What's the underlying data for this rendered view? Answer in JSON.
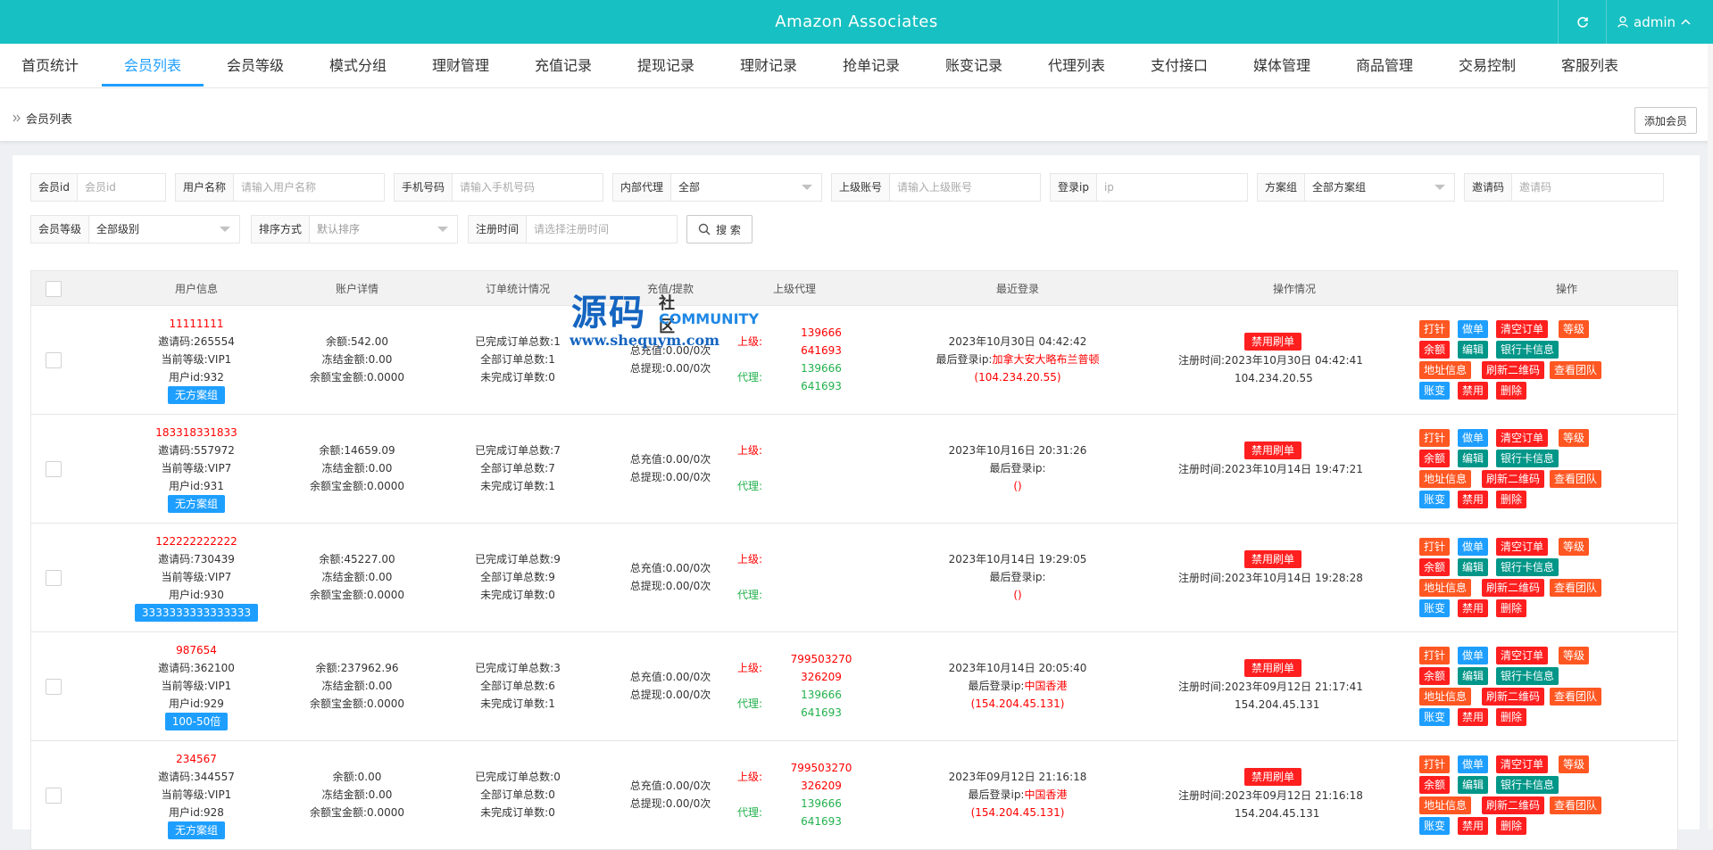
{
  "app": {
    "title": "Amazon Associates",
    "user": "admin"
  },
  "nav": {
    "items": [
      "首页统计",
      "会员列表",
      "会员等级",
      "模式分组",
      "理财管理",
      "充值记录",
      "提现记录",
      "理财记录",
      "抢单记录",
      "账变记录",
      "代理列表",
      "支付接口",
      "媒体管理",
      "商品管理",
      "交易控制",
      "客服列表"
    ],
    "active_index": 1
  },
  "breadcrumb": "会员列表",
  "add_button": "添加会员",
  "filters": {
    "member_id": {
      "label": "会员id",
      "placeholder": "会员id"
    },
    "username": {
      "label": "用户名称",
      "placeholder": "请输入用户名称"
    },
    "phone": {
      "label": "手机号码",
      "placeholder": "请输入手机号码"
    },
    "agent": {
      "label": "内部代理",
      "value": "全部"
    },
    "parent": {
      "label": "上级账号",
      "placeholder": "请输入上级账号"
    },
    "login_ip": {
      "label": "登录ip",
      "placeholder": "ip"
    },
    "plan": {
      "label": "方案组",
      "value": "全部方案组"
    },
    "invite": {
      "label": "邀请码",
      "placeholder": "邀请码"
    },
    "level": {
      "label": "会员等级",
      "value": "全部级别"
    },
    "sort": {
      "label": "排序方式",
      "value": "默认排序"
    },
    "reg_time": {
      "label": "注册时间",
      "placeholder": "请选择注册时间"
    },
    "search_label": "搜 索"
  },
  "table": {
    "headers": [
      "用户信息",
      "账户详情",
      "订单统计情况",
      "充值/提款",
      "上级代理",
      "最近登录",
      "操作情况",
      "操作"
    ],
    "rows": [
      {
        "username": "11111111",
        "invite": "邀请码:265554",
        "level": "当前等级:VIP1",
        "uid": "用户id:932",
        "group": "无方案组",
        "balance": "余额:542.00",
        "frozen": "冻结金额:0.00",
        "treasure": "余额宝金额:0.0000",
        "done": "已完成订单总数:1",
        "total": "全部订单总数:1",
        "pending": "未完成订单数:0",
        "recharge": "总充值:0.00/0次",
        "withdraw": "总提现:0.00/0次",
        "up_label": "上级:",
        "agent_label": "代理:",
        "up": [
          "139666",
          "641693"
        ],
        "agent": [
          "139666",
          "641693"
        ],
        "login_time": "2023年10月30日 04:42:42",
        "login_ip_label": "最后登录ip:",
        "login_loc": "加拿大安大略布兰普顿",
        "login_ip": "(104.234.20.55)",
        "ban": "禁用刷单",
        "reg_label": "注册时间:",
        "reg_time": "2023年10月30日 04:42:41",
        "reg_ip": "104.234.20.55"
      },
      {
        "username": "183318331833",
        "invite": "邀请码:557972",
        "level": "当前等级:VIP7",
        "uid": "用户id:931",
        "group": "无方案组",
        "balance": "余额:14659.09",
        "frozen": "冻结金额:0.00",
        "treasure": "余额宝金额:0.0000",
        "done": "已完成订单总数:7",
        "total": "全部订单总数:7",
        "pending": "未完成订单数:1",
        "recharge": "总充值:0.00/0次",
        "withdraw": "总提现:0.00/0次",
        "up_label": "上级:",
        "agent_label": "代理:",
        "up": [],
        "agent": [],
        "login_time": "2023年10月16日 20:31:26",
        "login_ip_label": "最后登录ip:",
        "login_loc": "",
        "login_ip": "()",
        "ban": "禁用刷单",
        "reg_label": "注册时间:",
        "reg_time": "2023年10月14日 19:47:21",
        "reg_ip": ""
      },
      {
        "username": "122222222222",
        "invite": "邀请码:730439",
        "level": "当前等级:VIP7",
        "uid": "用户id:930",
        "group": "3333333333333333",
        "balance": "余额:45227.00",
        "frozen": "冻结金额:0.00",
        "treasure": "余额宝金额:0.0000",
        "done": "已完成订单总数:9",
        "total": "全部订单总数:9",
        "pending": "未完成订单数:0",
        "recharge": "总充值:0.00/0次",
        "withdraw": "总提现:0.00/0次",
        "up_label": "上级:",
        "agent_label": "代理:",
        "up": [],
        "agent": [],
        "login_time": "2023年10月14日 19:29:05",
        "login_ip_label": "最后登录ip:",
        "login_loc": "",
        "login_ip": "()",
        "ban": "禁用刷单",
        "reg_label": "注册时间:",
        "reg_time": "2023年10月14日 19:28:28",
        "reg_ip": ""
      },
      {
        "username": "987654",
        "invite": "邀请码:362100",
        "level": "当前等级:VIP1",
        "uid": "用户id:929",
        "group": "100-50倍",
        "balance": "余额:237962.96",
        "frozen": "冻结金额:0.00",
        "treasure": "余额宝金额:0.0000",
        "done": "已完成订单总数:3",
        "total": "全部订单总数:6",
        "pending": "未完成订单数:1",
        "recharge": "总充值:0.00/0次",
        "withdraw": "总提现:0.00/0次",
        "up_label": "上级:",
        "agent_label": "代理:",
        "up": [
          "799503270",
          "326209"
        ],
        "agent": [
          "139666",
          "641693"
        ],
        "login_time": "2023年10月14日 20:05:40",
        "login_ip_label": "最后登录ip:",
        "login_loc": "中国香港",
        "login_ip": "(154.204.45.131)",
        "ban": "禁用刷单",
        "reg_label": "注册时间:",
        "reg_time": "2023年09月12日 21:17:41",
        "reg_ip": "154.204.45.131"
      },
      {
        "username": "234567",
        "invite": "邀请码:344557",
        "level": "当前等级:VIP1",
        "uid": "用户id:928",
        "group": "无方案组",
        "balance": "余额:0.00",
        "frozen": "冻结金额:0.00",
        "treasure": "余额宝金额:0.0000",
        "done": "已完成订单总数:0",
        "total": "全部订单总数:0",
        "pending": "未完成订单数:0",
        "recharge": "总充值:0.00/0次",
        "withdraw": "总提现:0.00/0次",
        "up_label": "上级:",
        "agent_label": "代理:",
        "up": [
          "799503270",
          "326209"
        ],
        "agent": [
          "139666",
          "641693"
        ],
        "login_time": "2023年09月12日 21:16:18",
        "login_ip_label": "最后登录ip:",
        "login_loc": "中国香港",
        "login_ip": "(154.204.45.131)",
        "ban": "禁用刷单",
        "reg_label": "注册时间:",
        "reg_time": "2023年09月12日 21:16:18",
        "reg_ip": "154.204.45.131"
      }
    ],
    "actions": [
      [
        {
          "label": "打针",
          "color": "#ff5722"
        },
        {
          "label": "做单",
          "color": "#1e9fff"
        },
        {
          "label": "清空订单",
          "color": "#ff1f1f"
        },
        {
          "label": "等级",
          "color": "#ff5722"
        }
      ],
      [
        {
          "label": "余额",
          "color": "#ff1f1f"
        },
        {
          "label": "编辑",
          "color": "#009688"
        },
        {
          "label": "银行卡信息",
          "color": "#009688"
        }
      ],
      [
        {
          "label": "地址信息",
          "color": "#ff5722"
        },
        {
          "label": "刷新二维码",
          "color": "#ff1f1f"
        },
        {
          "label": "查看团队",
          "color": "#ff5722"
        }
      ],
      [
        {
          "label": "账变",
          "color": "#1e9fff"
        },
        {
          "label": "禁用",
          "color": "#ff1f1f"
        },
        {
          "label": "删除",
          "color": "#ff1f1f"
        }
      ]
    ]
  },
  "watermark": {
    "big": "源码",
    "sub": "社区",
    "comm": "COMMUNITY",
    "url": "www.shequym.com"
  }
}
